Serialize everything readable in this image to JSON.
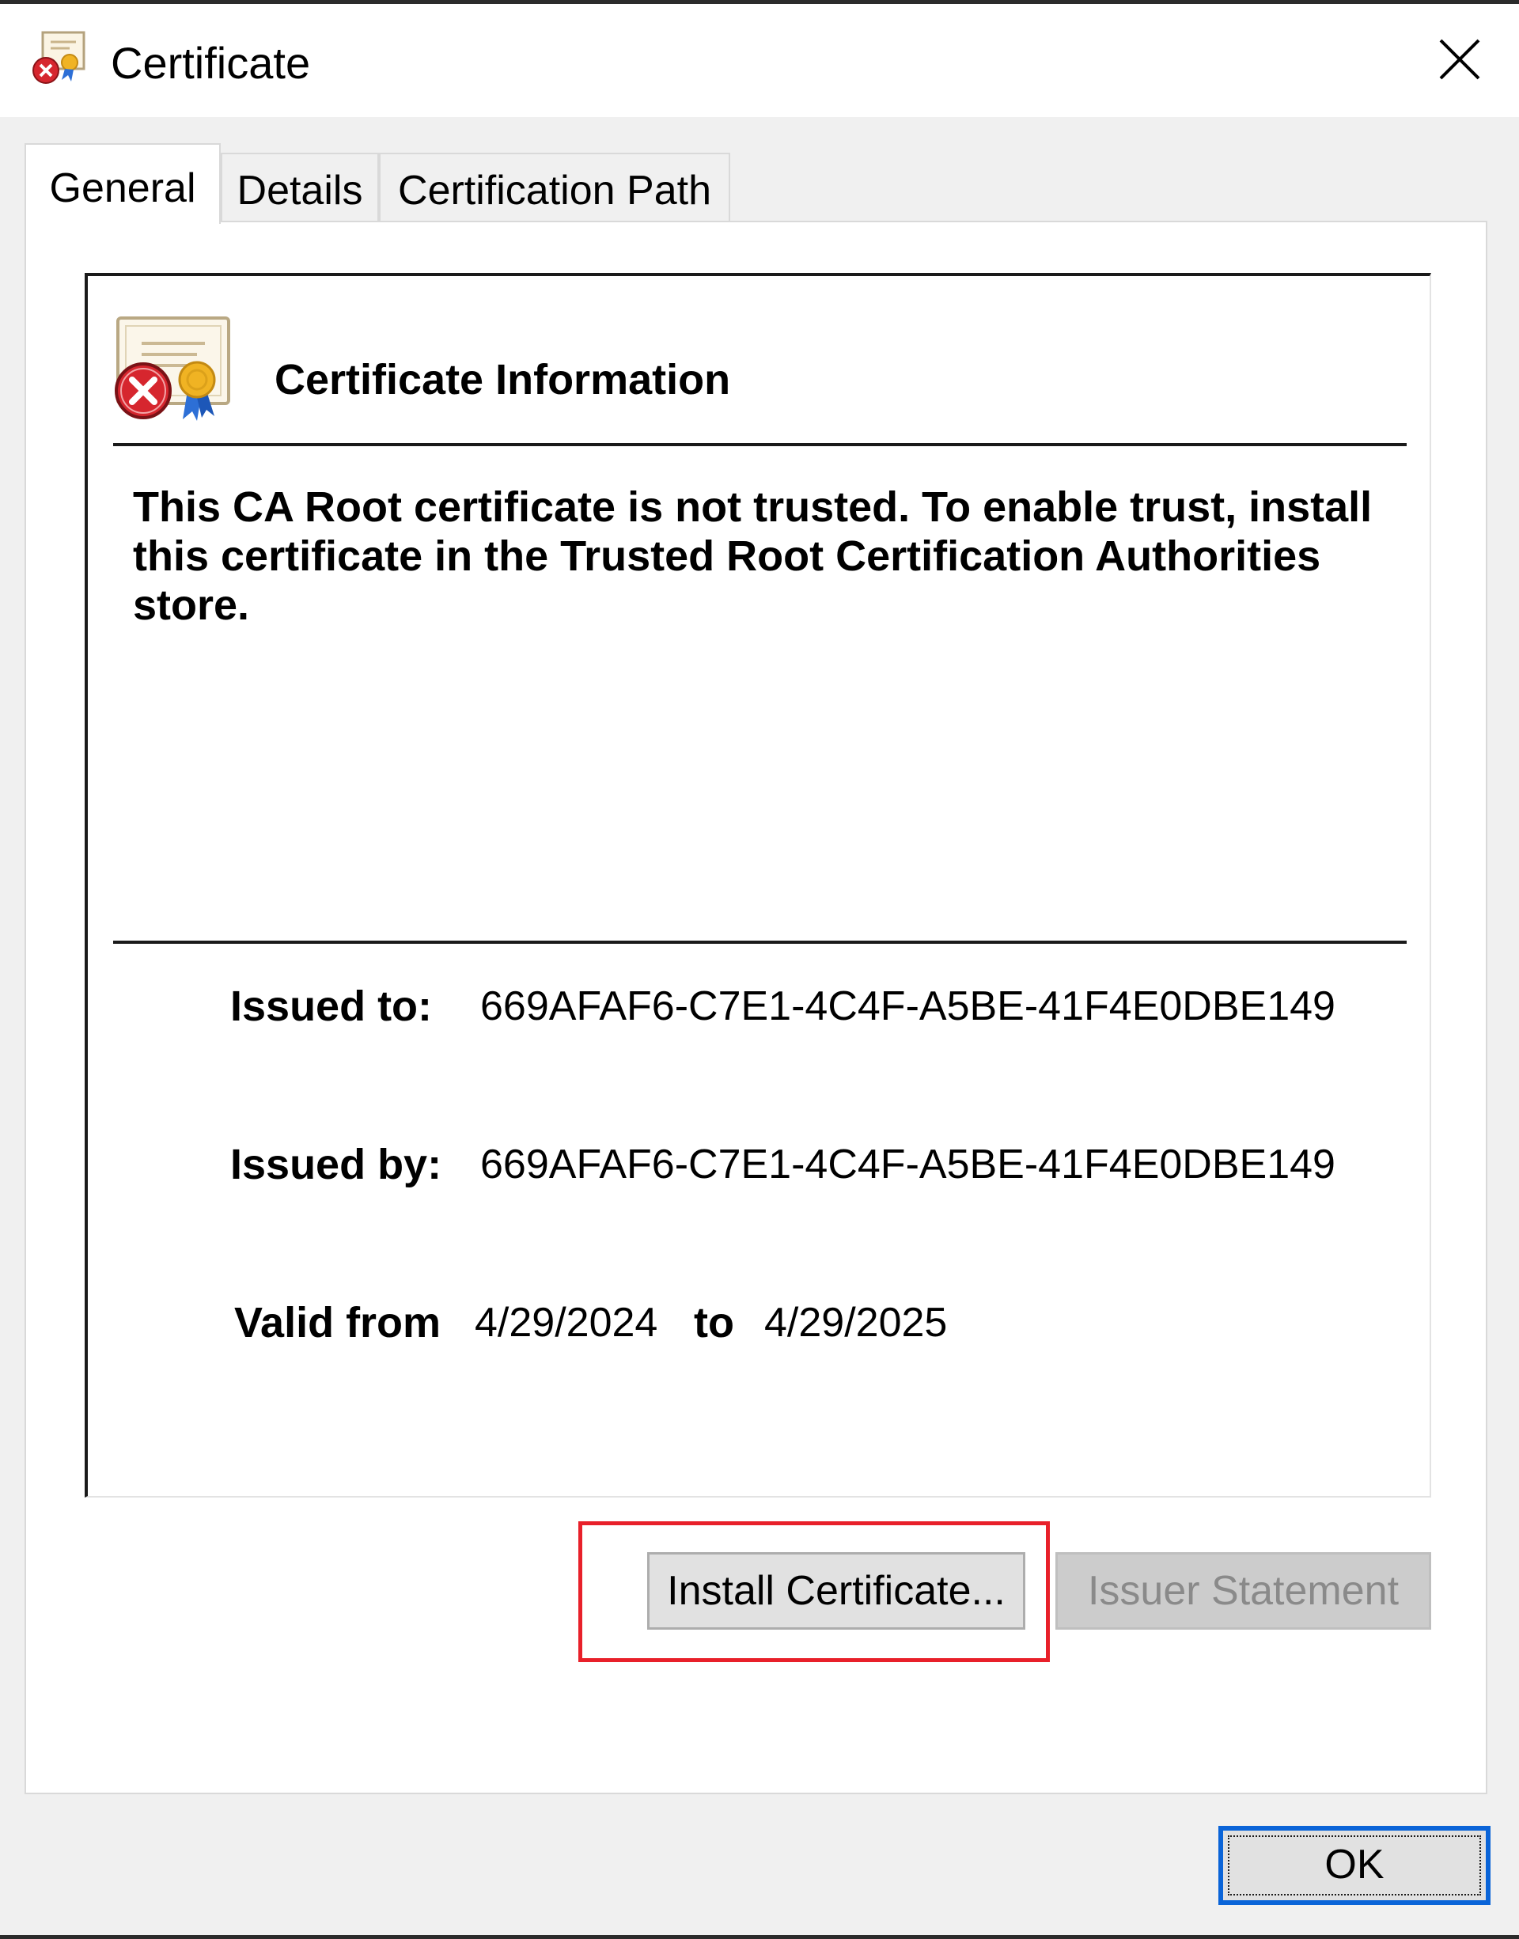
{
  "window": {
    "title": "Certificate"
  },
  "tabs": [
    {
      "label": "General",
      "active": true
    },
    {
      "label": "Details",
      "active": false
    },
    {
      "label": "Certification Path",
      "active": false
    }
  ],
  "info": {
    "heading": "Certificate Information",
    "message": "This CA Root certificate is not trusted. To enable trust, install this certificate in the Trusted Root Certification Authorities store.",
    "issued_to_label": "Issued to:",
    "issued_to_value": "669AFAF6-C7E1-4C4F-A5BE-41F4E0DBE149",
    "issued_by_label": "Issued by:",
    "issued_by_value": "669AFAF6-C7E1-4C4F-A5BE-41F4E0DBE149",
    "valid_from_label": "Valid from",
    "valid_from_value": "4/29/2024",
    "valid_to_label": "to",
    "valid_to_value": "4/29/2025"
  },
  "buttons": {
    "install": "Install Certificate...",
    "issuer_statement": "Issuer Statement",
    "ok": "OK"
  },
  "icons": {
    "window": "certificate-error-icon",
    "close": "close-icon",
    "certificate": "certificate-error-icon"
  },
  "colors": {
    "highlight": "#e8202a",
    "focus": "#0a64d8",
    "error": "#d6262e"
  }
}
